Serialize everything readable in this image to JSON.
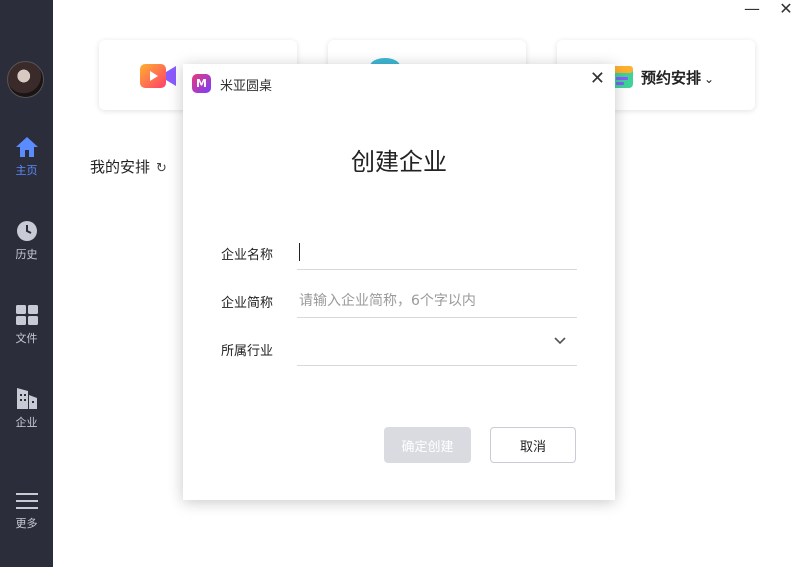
{
  "window_controls": {
    "minimize": "—",
    "close": "✕"
  },
  "sidebar": {
    "items": [
      {
        "label": "主页",
        "icon": "home-icon",
        "active": true
      },
      {
        "label": "历史",
        "icon": "clock-icon",
        "active": false
      },
      {
        "label": "文件",
        "icon": "grid-icon",
        "active": false
      },
      {
        "label": "企业",
        "icon": "building-icon",
        "active": false
      },
      {
        "label": "更多",
        "icon": "menu-icon",
        "active": false
      }
    ],
    "accent_color": "#5b8cff"
  },
  "cards": {
    "schedule_label": "预约安排",
    "schedule_chevron": "⌄"
  },
  "main": {
    "my_schedule": "我的安排",
    "refresh_glyph": "↻"
  },
  "dialog": {
    "app_name": "米亚圆桌",
    "logo_glyph": "M",
    "close_glyph": "✕",
    "title": "创建企业",
    "fields": {
      "name_label": "企业名称",
      "name_value": "",
      "short_name_label": "企业简称",
      "short_name_placeholder": "请输入企业简称，6个字以内",
      "industry_label": "所属行业",
      "industry_value": ""
    },
    "confirm_label": "确定创建",
    "cancel_label": "取消"
  }
}
